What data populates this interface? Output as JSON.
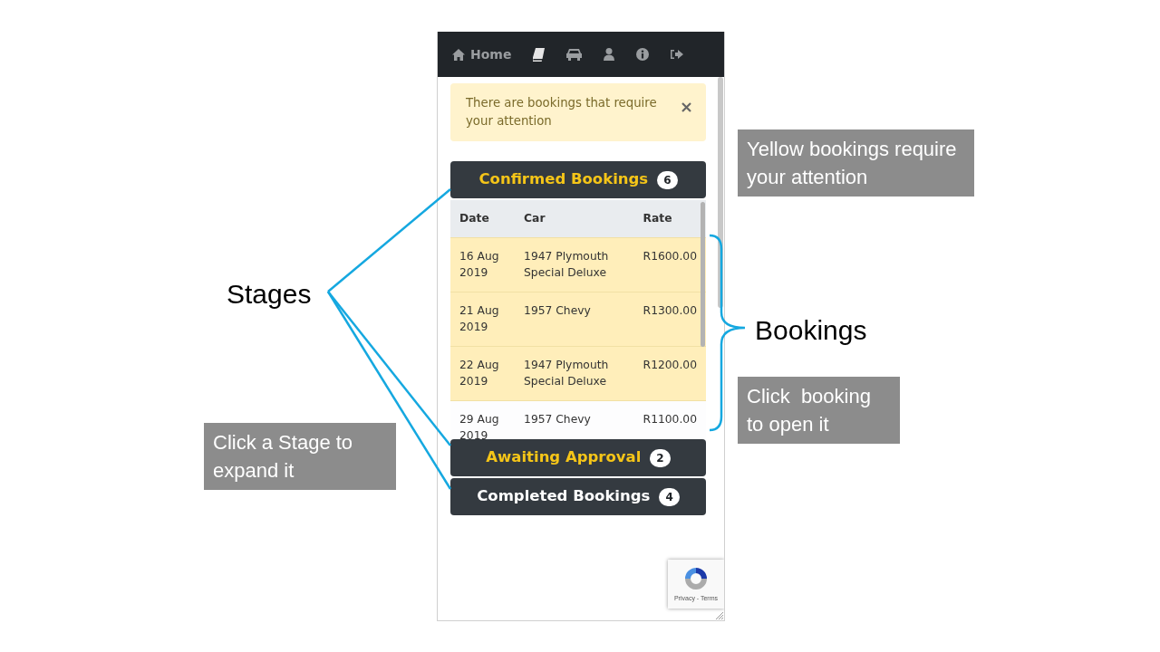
{
  "nav": {
    "items": [
      {
        "kind": "home",
        "label": "Home"
      },
      {
        "kind": "book"
      },
      {
        "kind": "car"
      },
      {
        "kind": "user"
      },
      {
        "kind": "info"
      },
      {
        "kind": "logout"
      }
    ]
  },
  "alert": {
    "text": "There are bookings that require your attention"
  },
  "stages": [
    {
      "title": "Confirmed Bookings",
      "count": "6",
      "attention": true,
      "expanded": true,
      "columns": [
        "Date",
        "Car",
        "Rate"
      ],
      "rows": [
        {
          "date": "16 Aug 2019",
          "car": "1947 Plymouth Special Deluxe",
          "rate": "R1600.00",
          "attention": true
        },
        {
          "date": "21 Aug 2019",
          "car": "1957 Chevy",
          "rate": "R1300.00",
          "attention": true
        },
        {
          "date": "22 Aug 2019",
          "car": "1947 Plymouth Special Deluxe",
          "rate": "R1200.00",
          "attention": true
        },
        {
          "date": "29 Aug 2019",
          "car": "1957 Chevy",
          "rate": "R1100.00",
          "attention": false
        }
      ]
    },
    {
      "title": "Awaiting Approval",
      "count": "2",
      "attention": true,
      "expanded": false
    },
    {
      "title": "Completed Bookings",
      "count": "4",
      "attention": false,
      "expanded": false
    }
  ],
  "recaptcha": {
    "links": "Privacy - Terms"
  },
  "annotations": [
    {
      "kind": "box",
      "text": "Yellow bookings require your attention"
    },
    {
      "kind": "label",
      "text": "Stages"
    },
    {
      "kind": "label",
      "text": "Bookings"
    },
    {
      "kind": "box",
      "text": "Click  booking to open it"
    },
    {
      "kind": "box",
      "text": "Click a Stage to expand it"
    }
  ]
}
